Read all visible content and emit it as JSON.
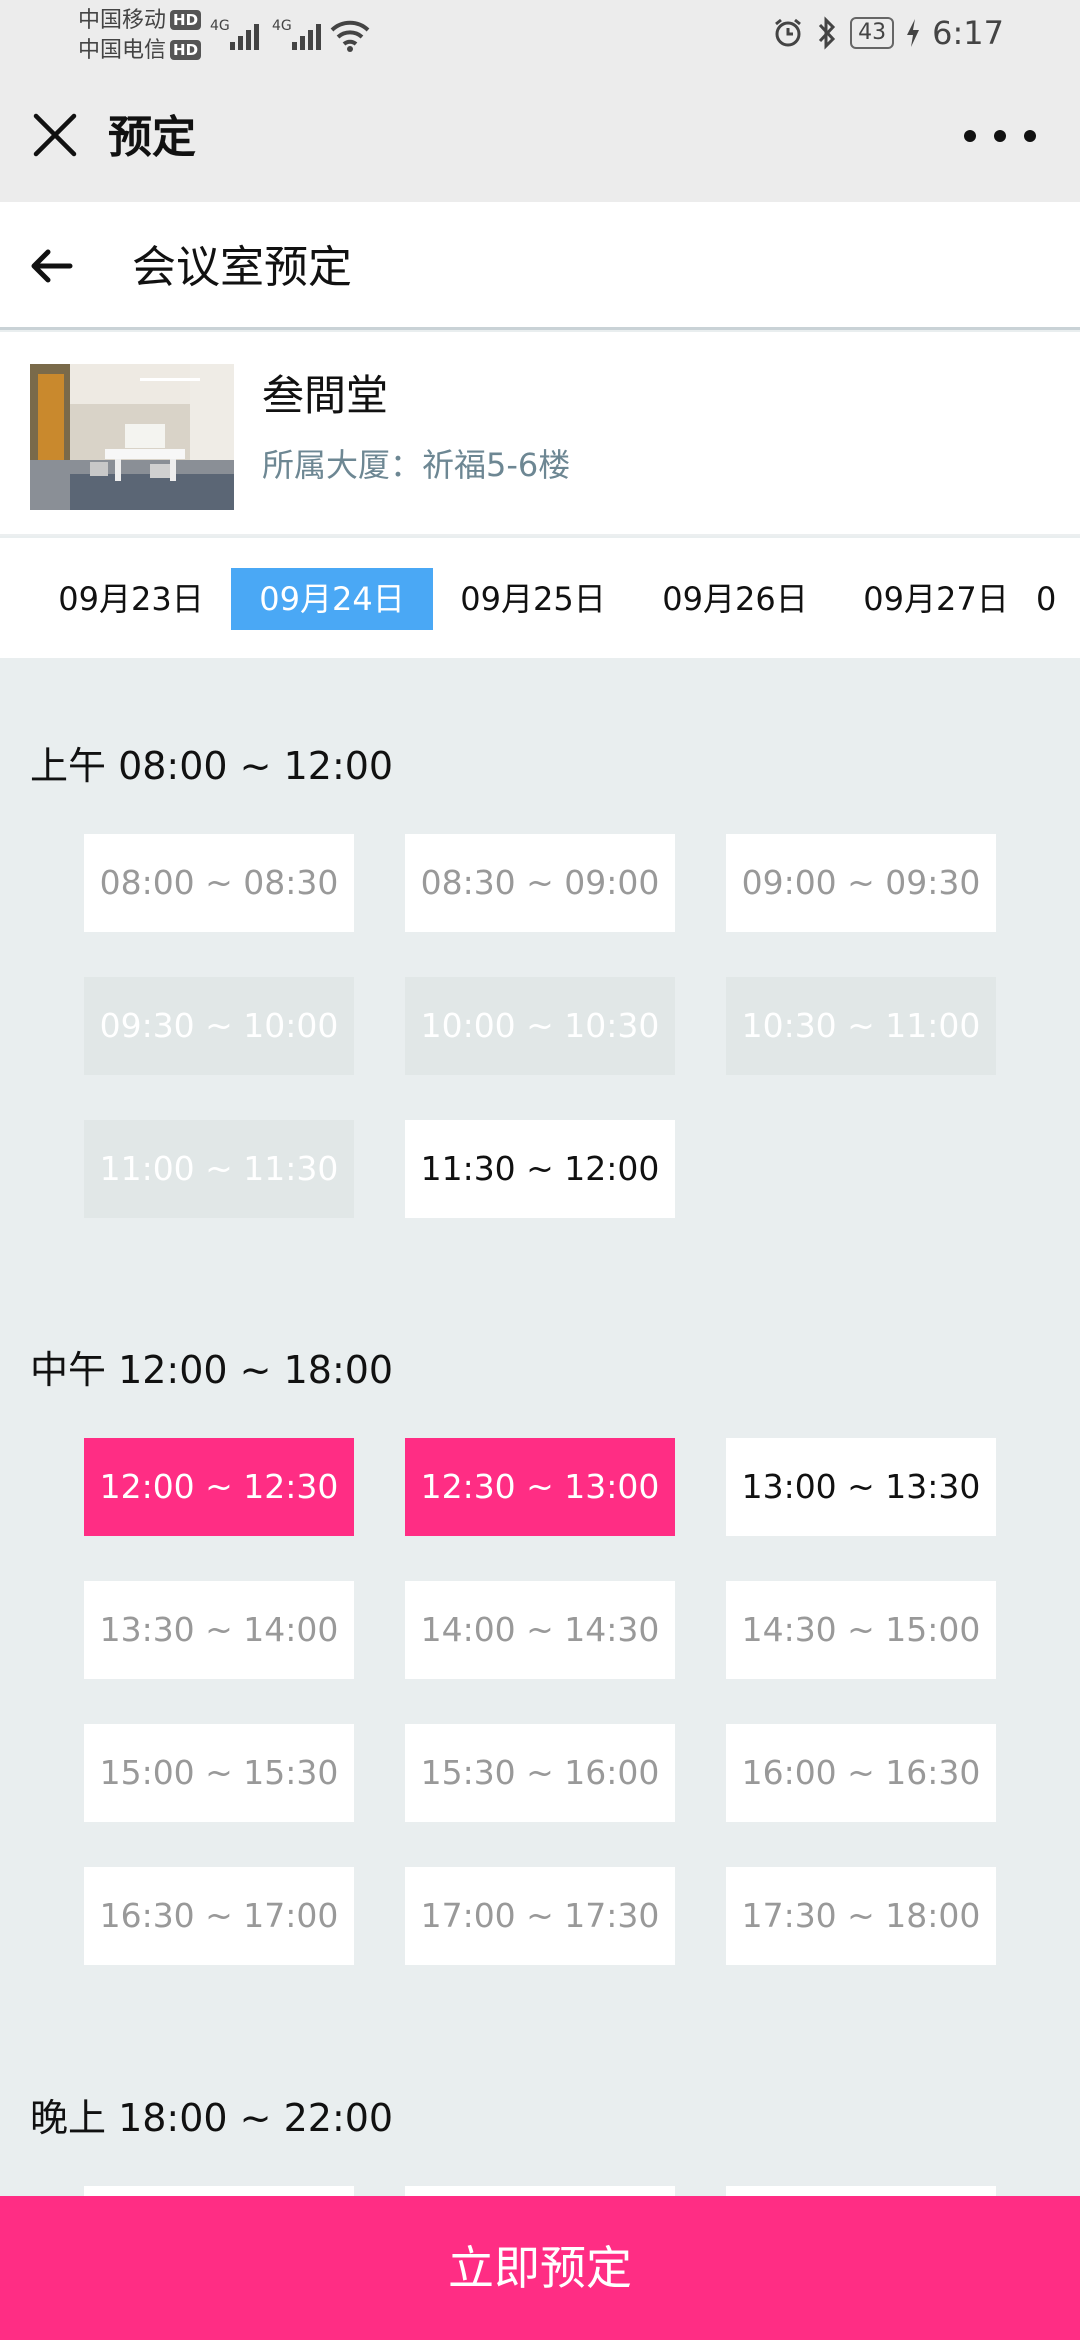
{
  "status_bar": {
    "carrier1": "中国移动",
    "carrier2": "中国电信",
    "hd": "HD",
    "net1": "4G",
    "net2": "4G",
    "battery": "43",
    "time": "6:17"
  },
  "app_bar": {
    "title": "预定"
  },
  "nav": {
    "title": "会议室预定"
  },
  "room": {
    "name": "叁間堂",
    "building": "所属大厦：祈福5-6楼"
  },
  "dates": [
    "09月23日",
    "09月24日",
    "09月25日",
    "09月26日",
    "09月27日",
    "0"
  ],
  "selected_date_index": 1,
  "sections": [
    {
      "title": "上午 08:00 ~ 12:00",
      "slots": [
        {
          "label": "08:00 ~ 08:30",
          "state": "past"
        },
        {
          "label": "08:30 ~ 09:00",
          "state": "past"
        },
        {
          "label": "09:00 ~ 09:30",
          "state": "past"
        },
        {
          "label": "09:30 ~ 10:00",
          "state": "disabled"
        },
        {
          "label": "10:00 ~ 10:30",
          "state": "disabled"
        },
        {
          "label": "10:30 ~ 11:00",
          "state": "disabled"
        },
        {
          "label": "11:00 ~ 11:30",
          "state": "disabled"
        },
        {
          "label": "11:30 ~ 12:00",
          "state": "available"
        }
      ]
    },
    {
      "title": "中午 12:00 ~ 18:00",
      "slots": [
        {
          "label": "12:00 ~ 12:30",
          "state": "selected"
        },
        {
          "label": "12:30 ~ 13:00",
          "state": "selected"
        },
        {
          "label": "13:00 ~ 13:30",
          "state": "available"
        },
        {
          "label": "13:30 ~ 14:00",
          "state": "past"
        },
        {
          "label": "14:00 ~ 14:30",
          "state": "past"
        },
        {
          "label": "14:30 ~ 15:00",
          "state": "past"
        },
        {
          "label": "15:00 ~ 15:30",
          "state": "past"
        },
        {
          "label": "15:30 ~ 16:00",
          "state": "past"
        },
        {
          "label": "16:00 ~ 16:30",
          "state": "past"
        },
        {
          "label": "16:30 ~ 17:00",
          "state": "past"
        },
        {
          "label": "17:00 ~ 17:30",
          "state": "past"
        },
        {
          "label": "17:30 ~ 18:00",
          "state": "past"
        }
      ]
    },
    {
      "title": "晚上 18:00 ~ 22:00",
      "slots": []
    }
  ],
  "book_button": "立即预定",
  "colors": {
    "accent": "#ff2d84",
    "date_active": "#4aa8f5",
    "muted": "#6d8793"
  }
}
